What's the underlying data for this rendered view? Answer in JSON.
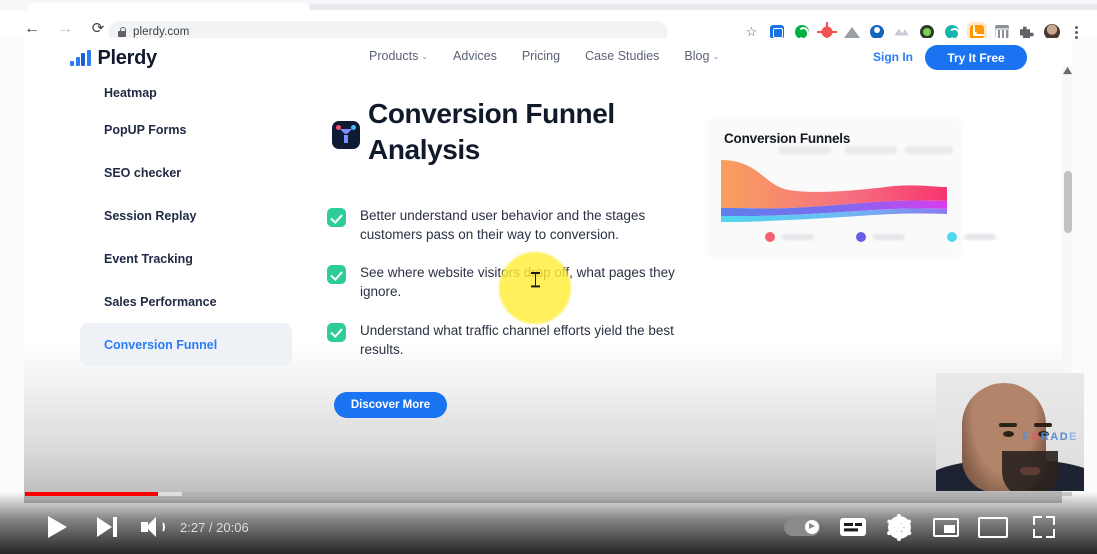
{
  "browser": {
    "url": "plerdy.com",
    "nav": {
      "back": "←",
      "forward": "→",
      "reload": "⟳"
    },
    "toolbar_icons": [
      "bookmark-star-icon",
      "extension-blue-square-icon",
      "extension-grammarly-icon",
      "extension-target-icon",
      "extension-peak-icon",
      "extension-blue-circle-icon",
      "extension-gray-mountain-icon",
      "extension-dark-green-icon",
      "extension-teal-c-icon",
      "extension-rss-icon",
      "extension-film-icon",
      "extensions-puzzle-icon",
      "profile-avatar-icon",
      "chrome-menu-icon"
    ]
  },
  "site": {
    "logo_text": "Plerdy",
    "nav": [
      {
        "label": "Products",
        "has_caret": true
      },
      {
        "label": "Advices",
        "has_caret": false
      },
      {
        "label": "Pricing",
        "has_caret": false
      },
      {
        "label": "Case Studies",
        "has_caret": false
      },
      {
        "label": "Blog",
        "has_caret": true
      }
    ],
    "sign_in": "Sign In",
    "try_free": "Try It Free",
    "caret_glyph": "⌄"
  },
  "products_sidebar": {
    "items": [
      {
        "label": "Heatmap",
        "active": false,
        "clipped": true
      },
      {
        "label": "PopUP Forms",
        "active": false,
        "clipped": false
      },
      {
        "label": "SEO checker",
        "active": false,
        "clipped": false
      },
      {
        "label": "Session Replay",
        "active": false,
        "clipped": false
      },
      {
        "label": "Event Tracking",
        "active": false,
        "clipped": false
      },
      {
        "label": "Sales Performance",
        "active": false,
        "clipped": false
      },
      {
        "label": "Conversion Funnel",
        "active": true,
        "clipped": false
      }
    ]
  },
  "hero": {
    "icon_name": "conversion-funnel-icon",
    "title": "Conversion Funnel Analysis",
    "bullets": [
      "Better understand user behavior and the stages customers pass on their way to conversion.",
      "See where website visitors drop off, what pages they ignore.",
      "Understand what traffic channel efforts yield the best results."
    ],
    "cta_label": "Discover More"
  },
  "funnel_card": {
    "title": "Conversion Funnels",
    "legend": [
      {
        "color": "#f4626f"
      },
      {
        "color": "#6b5ce7"
      },
      {
        "color": "#4fd8f0"
      }
    ],
    "colors": {
      "band_top_start": "#f9a05c",
      "band_top_end": "#f8356f",
      "band_mid_start": "#7b6cf0",
      "band_mid_end": "#d93cf0",
      "band_bottom_start": "#4fd8f0",
      "band_bottom_end": "#8a7cf0"
    }
  },
  "player": {
    "current_time": "2:27",
    "duration": "20:06",
    "time_display": "2:27 / 20:06",
    "progress_color": "#ff0000",
    "left_controls": [
      "play-button",
      "next-video-button",
      "volume-button"
    ],
    "right_controls": [
      "autoplay-toggle",
      "subtitles-button",
      "settings-gear-button",
      "miniplayer-button",
      "theater-mode-button",
      "fullscreen-button"
    ]
  },
  "webcam": {
    "watermark": {
      "c1": "F",
      "c2": "G",
      "c3": "RAD",
      "c4": "E"
    }
  }
}
